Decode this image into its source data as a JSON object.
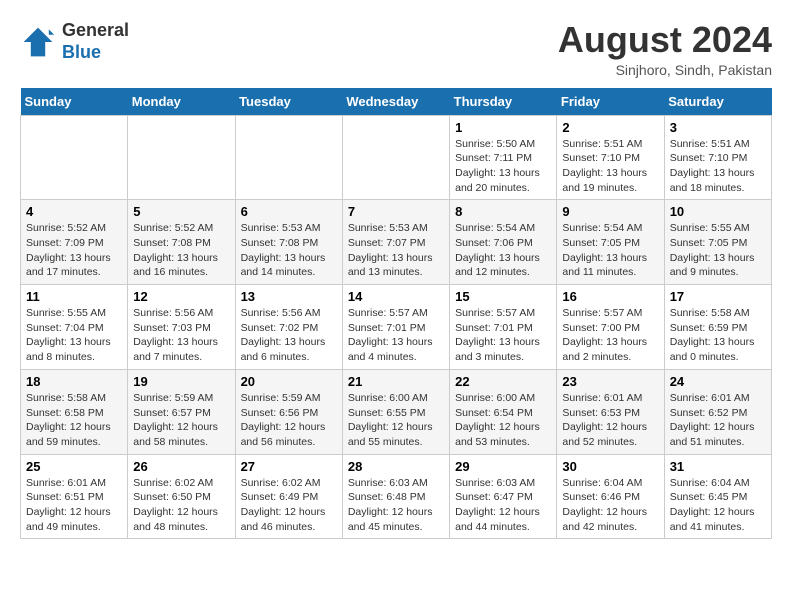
{
  "header": {
    "logo_line1": "General",
    "logo_line2": "Blue",
    "month_title": "August 2024",
    "subtitle": "Sinjhoro, Sindh, Pakistan"
  },
  "weekdays": [
    "Sunday",
    "Monday",
    "Tuesday",
    "Wednesday",
    "Thursday",
    "Friday",
    "Saturday"
  ],
  "weeks": [
    [
      {
        "day": "",
        "info": ""
      },
      {
        "day": "",
        "info": ""
      },
      {
        "day": "",
        "info": ""
      },
      {
        "day": "",
        "info": ""
      },
      {
        "day": "1",
        "info": "Sunrise: 5:50 AM\nSunset: 7:11 PM\nDaylight: 13 hours\nand 20 minutes."
      },
      {
        "day": "2",
        "info": "Sunrise: 5:51 AM\nSunset: 7:10 PM\nDaylight: 13 hours\nand 19 minutes."
      },
      {
        "day": "3",
        "info": "Sunrise: 5:51 AM\nSunset: 7:10 PM\nDaylight: 13 hours\nand 18 minutes."
      }
    ],
    [
      {
        "day": "4",
        "info": "Sunrise: 5:52 AM\nSunset: 7:09 PM\nDaylight: 13 hours\nand 17 minutes."
      },
      {
        "day": "5",
        "info": "Sunrise: 5:52 AM\nSunset: 7:08 PM\nDaylight: 13 hours\nand 16 minutes."
      },
      {
        "day": "6",
        "info": "Sunrise: 5:53 AM\nSunset: 7:08 PM\nDaylight: 13 hours\nand 14 minutes."
      },
      {
        "day": "7",
        "info": "Sunrise: 5:53 AM\nSunset: 7:07 PM\nDaylight: 13 hours\nand 13 minutes."
      },
      {
        "day": "8",
        "info": "Sunrise: 5:54 AM\nSunset: 7:06 PM\nDaylight: 13 hours\nand 12 minutes."
      },
      {
        "day": "9",
        "info": "Sunrise: 5:54 AM\nSunset: 7:05 PM\nDaylight: 13 hours\nand 11 minutes."
      },
      {
        "day": "10",
        "info": "Sunrise: 5:55 AM\nSunset: 7:05 PM\nDaylight: 13 hours\nand 9 minutes."
      }
    ],
    [
      {
        "day": "11",
        "info": "Sunrise: 5:55 AM\nSunset: 7:04 PM\nDaylight: 13 hours\nand 8 minutes."
      },
      {
        "day": "12",
        "info": "Sunrise: 5:56 AM\nSunset: 7:03 PM\nDaylight: 13 hours\nand 7 minutes."
      },
      {
        "day": "13",
        "info": "Sunrise: 5:56 AM\nSunset: 7:02 PM\nDaylight: 13 hours\nand 6 minutes."
      },
      {
        "day": "14",
        "info": "Sunrise: 5:57 AM\nSunset: 7:01 PM\nDaylight: 13 hours\nand 4 minutes."
      },
      {
        "day": "15",
        "info": "Sunrise: 5:57 AM\nSunset: 7:01 PM\nDaylight: 13 hours\nand 3 minutes."
      },
      {
        "day": "16",
        "info": "Sunrise: 5:57 AM\nSunset: 7:00 PM\nDaylight: 13 hours\nand 2 minutes."
      },
      {
        "day": "17",
        "info": "Sunrise: 5:58 AM\nSunset: 6:59 PM\nDaylight: 13 hours\nand 0 minutes."
      }
    ],
    [
      {
        "day": "18",
        "info": "Sunrise: 5:58 AM\nSunset: 6:58 PM\nDaylight: 12 hours\nand 59 minutes."
      },
      {
        "day": "19",
        "info": "Sunrise: 5:59 AM\nSunset: 6:57 PM\nDaylight: 12 hours\nand 58 minutes."
      },
      {
        "day": "20",
        "info": "Sunrise: 5:59 AM\nSunset: 6:56 PM\nDaylight: 12 hours\nand 56 minutes."
      },
      {
        "day": "21",
        "info": "Sunrise: 6:00 AM\nSunset: 6:55 PM\nDaylight: 12 hours\nand 55 minutes."
      },
      {
        "day": "22",
        "info": "Sunrise: 6:00 AM\nSunset: 6:54 PM\nDaylight: 12 hours\nand 53 minutes."
      },
      {
        "day": "23",
        "info": "Sunrise: 6:01 AM\nSunset: 6:53 PM\nDaylight: 12 hours\nand 52 minutes."
      },
      {
        "day": "24",
        "info": "Sunrise: 6:01 AM\nSunset: 6:52 PM\nDaylight: 12 hours\nand 51 minutes."
      }
    ],
    [
      {
        "day": "25",
        "info": "Sunrise: 6:01 AM\nSunset: 6:51 PM\nDaylight: 12 hours\nand 49 minutes."
      },
      {
        "day": "26",
        "info": "Sunrise: 6:02 AM\nSunset: 6:50 PM\nDaylight: 12 hours\nand 48 minutes."
      },
      {
        "day": "27",
        "info": "Sunrise: 6:02 AM\nSunset: 6:49 PM\nDaylight: 12 hours\nand 46 minutes."
      },
      {
        "day": "28",
        "info": "Sunrise: 6:03 AM\nSunset: 6:48 PM\nDaylight: 12 hours\nand 45 minutes."
      },
      {
        "day": "29",
        "info": "Sunrise: 6:03 AM\nSunset: 6:47 PM\nDaylight: 12 hours\nand 44 minutes."
      },
      {
        "day": "30",
        "info": "Sunrise: 6:04 AM\nSunset: 6:46 PM\nDaylight: 12 hours\nand 42 minutes."
      },
      {
        "day": "31",
        "info": "Sunrise: 6:04 AM\nSunset: 6:45 PM\nDaylight: 12 hours\nand 41 minutes."
      }
    ]
  ]
}
